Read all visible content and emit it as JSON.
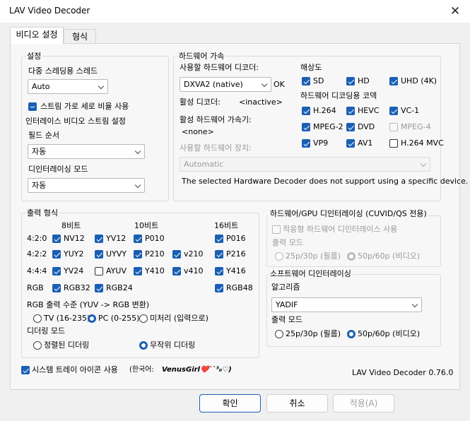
{
  "window": {
    "title": "LAV Video Decoder"
  },
  "tabs": [
    "비디오 설정",
    "형식"
  ],
  "settings": {
    "group_label": "설정",
    "threads_label": "다중 스레딩용 스레드",
    "threads_value": "Auto",
    "stream_ar_label": "스트림 가로 세로 비율 사용",
    "interlaced_label": "인터레이스 비디오 스트림 설정",
    "field_order_label": "필드 순서",
    "field_order_value": "자동",
    "deint_mode_label": "디인터레이싱 모드",
    "deint_mode_value": "자동"
  },
  "hw": {
    "group_label": "하드웨어 가속",
    "decoder_label": "사용할 하드웨어 디코더:",
    "decoder_value": "DXVA2 (native)",
    "decoder_status": "OK",
    "active_decoder_label": "활성 디코더:",
    "active_decoder_value": "<inactive>",
    "active_accel_label": "활성 하드웨어 가속기:",
    "active_accel_value": "<none>",
    "device_label": "사용할 하드웨어 장치:",
    "device_value": "Automatic",
    "note": "The selected Hardware Decoder does not support using a specific device.",
    "resolution_label": "해상도",
    "resolutions": [
      {
        "label": "SD",
        "checked": true
      },
      {
        "label": "HD",
        "checked": true
      },
      {
        "label": "UHD (4K)",
        "checked": true
      }
    ],
    "codecs_label": "하드웨어 디코딩용 코덱",
    "codecs": [
      {
        "label": "H.264",
        "checked": true,
        "enabled": true
      },
      {
        "label": "HEVC",
        "checked": true,
        "enabled": true
      },
      {
        "label": "VC-1",
        "checked": true,
        "enabled": true
      },
      {
        "label": "MPEG-2",
        "checked": true,
        "enabled": true
      },
      {
        "label": "DVD",
        "checked": true,
        "enabled": true
      },
      {
        "label": "MPEG-4",
        "checked": false,
        "enabled": false
      },
      {
        "label": "VP9",
        "checked": true,
        "enabled": true
      },
      {
        "label": "AV1",
        "checked": true,
        "enabled": true
      },
      {
        "label": "H.264 MVC",
        "checked": false,
        "enabled": true
      }
    ]
  },
  "output": {
    "group_label": "출력 형식",
    "col_headers": [
      "8비트",
      "10비트",
      "16비트"
    ],
    "row_labels": [
      "4:2:0",
      "4:2:2",
      "4:4:4",
      "RGB"
    ],
    "formats": [
      {
        "label": "NV12",
        "checked": true
      },
      {
        "label": "YV12",
        "checked": true
      },
      {
        "label": "P010",
        "checked": true
      },
      {
        "label": "P016",
        "checked": true
      },
      {
        "label": "YUY2",
        "checked": true
      },
      {
        "label": "UYVY",
        "checked": true
      },
      {
        "label": "P210",
        "checked": true
      },
      {
        "label": "v210",
        "checked": true
      },
      {
        "label": "P216",
        "checked": true
      },
      {
        "label": "YV24",
        "checked": true
      },
      {
        "label": "AYUV",
        "checked": false
      },
      {
        "label": "Y410",
        "checked": true
      },
      {
        "label": "v410",
        "checked": true
      },
      {
        "label": "Y416",
        "checked": true
      },
      {
        "label": "RGB32",
        "checked": true
      },
      {
        "label": "RGB24",
        "checked": true
      },
      {
        "label": "RGB48",
        "checked": true
      }
    ],
    "rgb_level_label": "RGB 출력 수준 (YUV -> RGB 변환)",
    "rgb_levels": [
      "TV (16-235)",
      "PC (0-255)",
      "미처리 (입력으로)"
    ],
    "rgb_selected": 1,
    "dither_label": "디더링 모드",
    "dithers": [
      "정렬된 디더링",
      "무작위 디더링"
    ],
    "dither_selected": 1
  },
  "hw_deint": {
    "group_label": "하드웨어/GPU 디인터레이싱 (CUVID/QS 전용)",
    "adaptive_label": "적응형 하드웨어 디인터레이스 사용",
    "output_mode_label": "출력 모드",
    "modes": [
      "25p/30p (필름)",
      "50p/60p (비디오)"
    ],
    "selected": 1
  },
  "sw_deint": {
    "group_label": "소프트웨어 디인터레이싱",
    "algorithm_label": "알고리즘",
    "algorithm_value": "YADIF",
    "output_mode_label": "출력 모드",
    "modes": [
      "25p/30p (필름)",
      "50p/60p (비디오)"
    ],
    "selected": 1
  },
  "footer": {
    "tray_label": "시스템 트레이 아이콘 사용",
    "translator_prefix": "(한국어: ",
    "translator_name": "VenusGirl❤️``³₀♡)",
    "version": "LAV Video Decoder 0.76.0"
  },
  "buttons": {
    "ok": "확인",
    "cancel": "취소",
    "apply": "적용(A)"
  },
  "colors": {
    "accent": "#1a5fb4",
    "background": "#f0f0f0",
    "panel": "#f7f7f7"
  }
}
